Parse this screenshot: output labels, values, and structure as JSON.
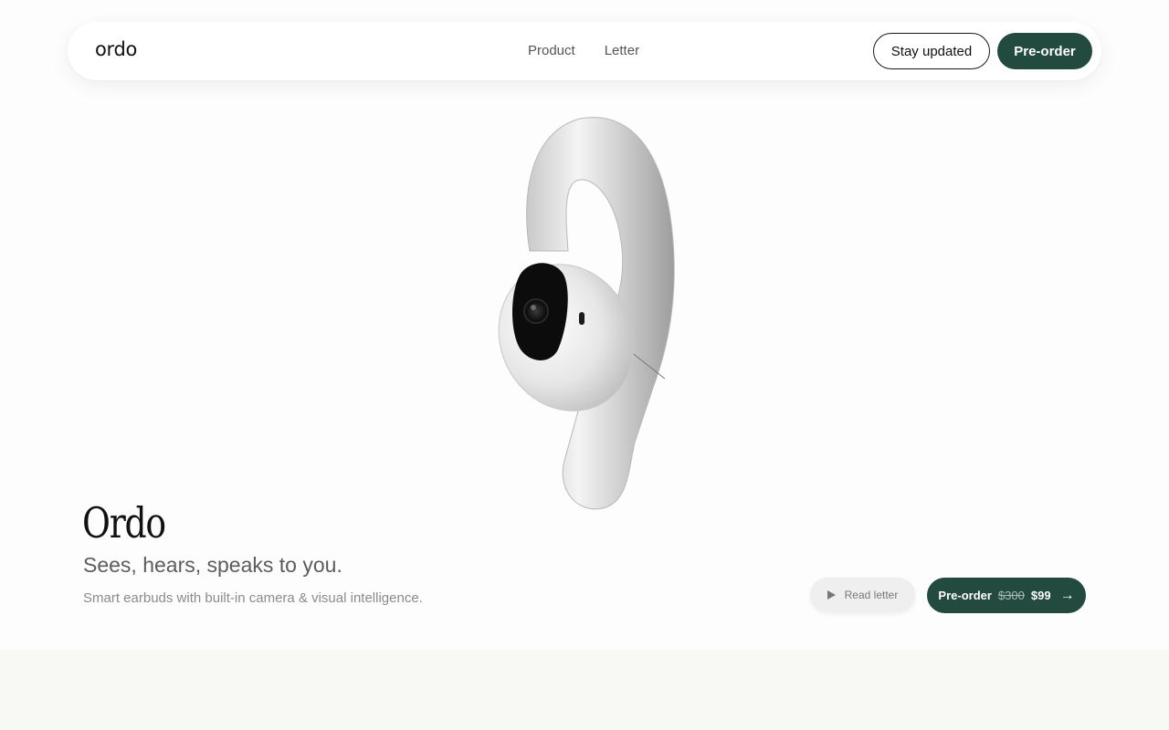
{
  "nav": {
    "logo": "ordo",
    "links": [
      "Product",
      "Letter"
    ],
    "stay_updated_label": "Stay updated",
    "preorder_label": "Pre-order"
  },
  "hero": {
    "title": "Ordo",
    "subtitle": "Sees, hears, speaks to you.",
    "description": "Smart earbuds with built-in camera & visual intelligence.",
    "read_letter_label": "Read letter",
    "cta": {
      "label": "Pre-order",
      "old_price": "$300",
      "price": "$99",
      "arrow": "→"
    }
  },
  "product_image": {
    "icon": "earbud-camera-image"
  },
  "colors": {
    "accent": "#224a3e",
    "background": "#fdfdfd",
    "band": "#f8f8f4"
  }
}
